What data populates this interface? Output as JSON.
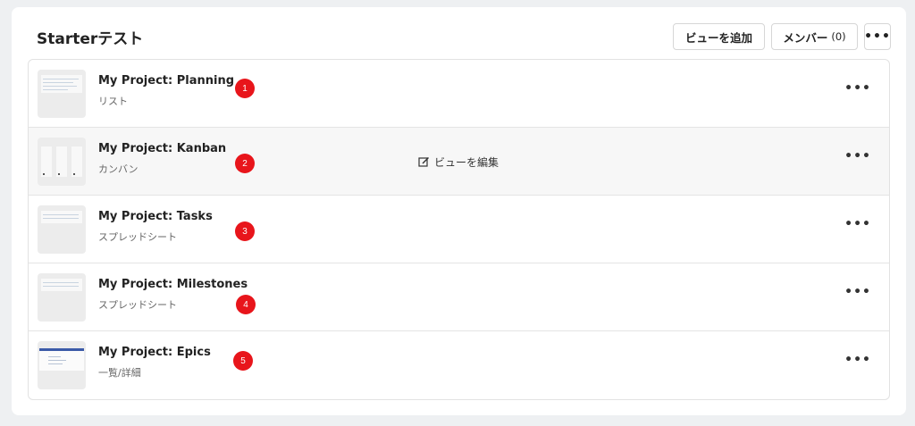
{
  "header": {
    "title": "Starterテスト",
    "add_view_label": "ビューを追加",
    "members_label": "メンバー",
    "members_count": "(0)",
    "more_icon": "more-horizontal-icon"
  },
  "views": [
    {
      "name": "My Project: Planning",
      "type": "リスト",
      "badge": "1"
    },
    {
      "name": "My Project: Kanban",
      "type": "カンバン",
      "badge": "2",
      "edit_label": "ビューを編集"
    },
    {
      "name": "My Project: Tasks",
      "type": "スプレッドシート",
      "badge": "3"
    },
    {
      "name": "My Project: Milestones",
      "type": "スプレッドシート",
      "badge": "4"
    },
    {
      "name": "My Project: Epics",
      "type": "一覧/詳細",
      "badge": "5"
    }
  ],
  "colors": {
    "badge": "#e8151b",
    "background": "#eef0f2",
    "epics_thumb_bar": "#3b5aa8"
  }
}
